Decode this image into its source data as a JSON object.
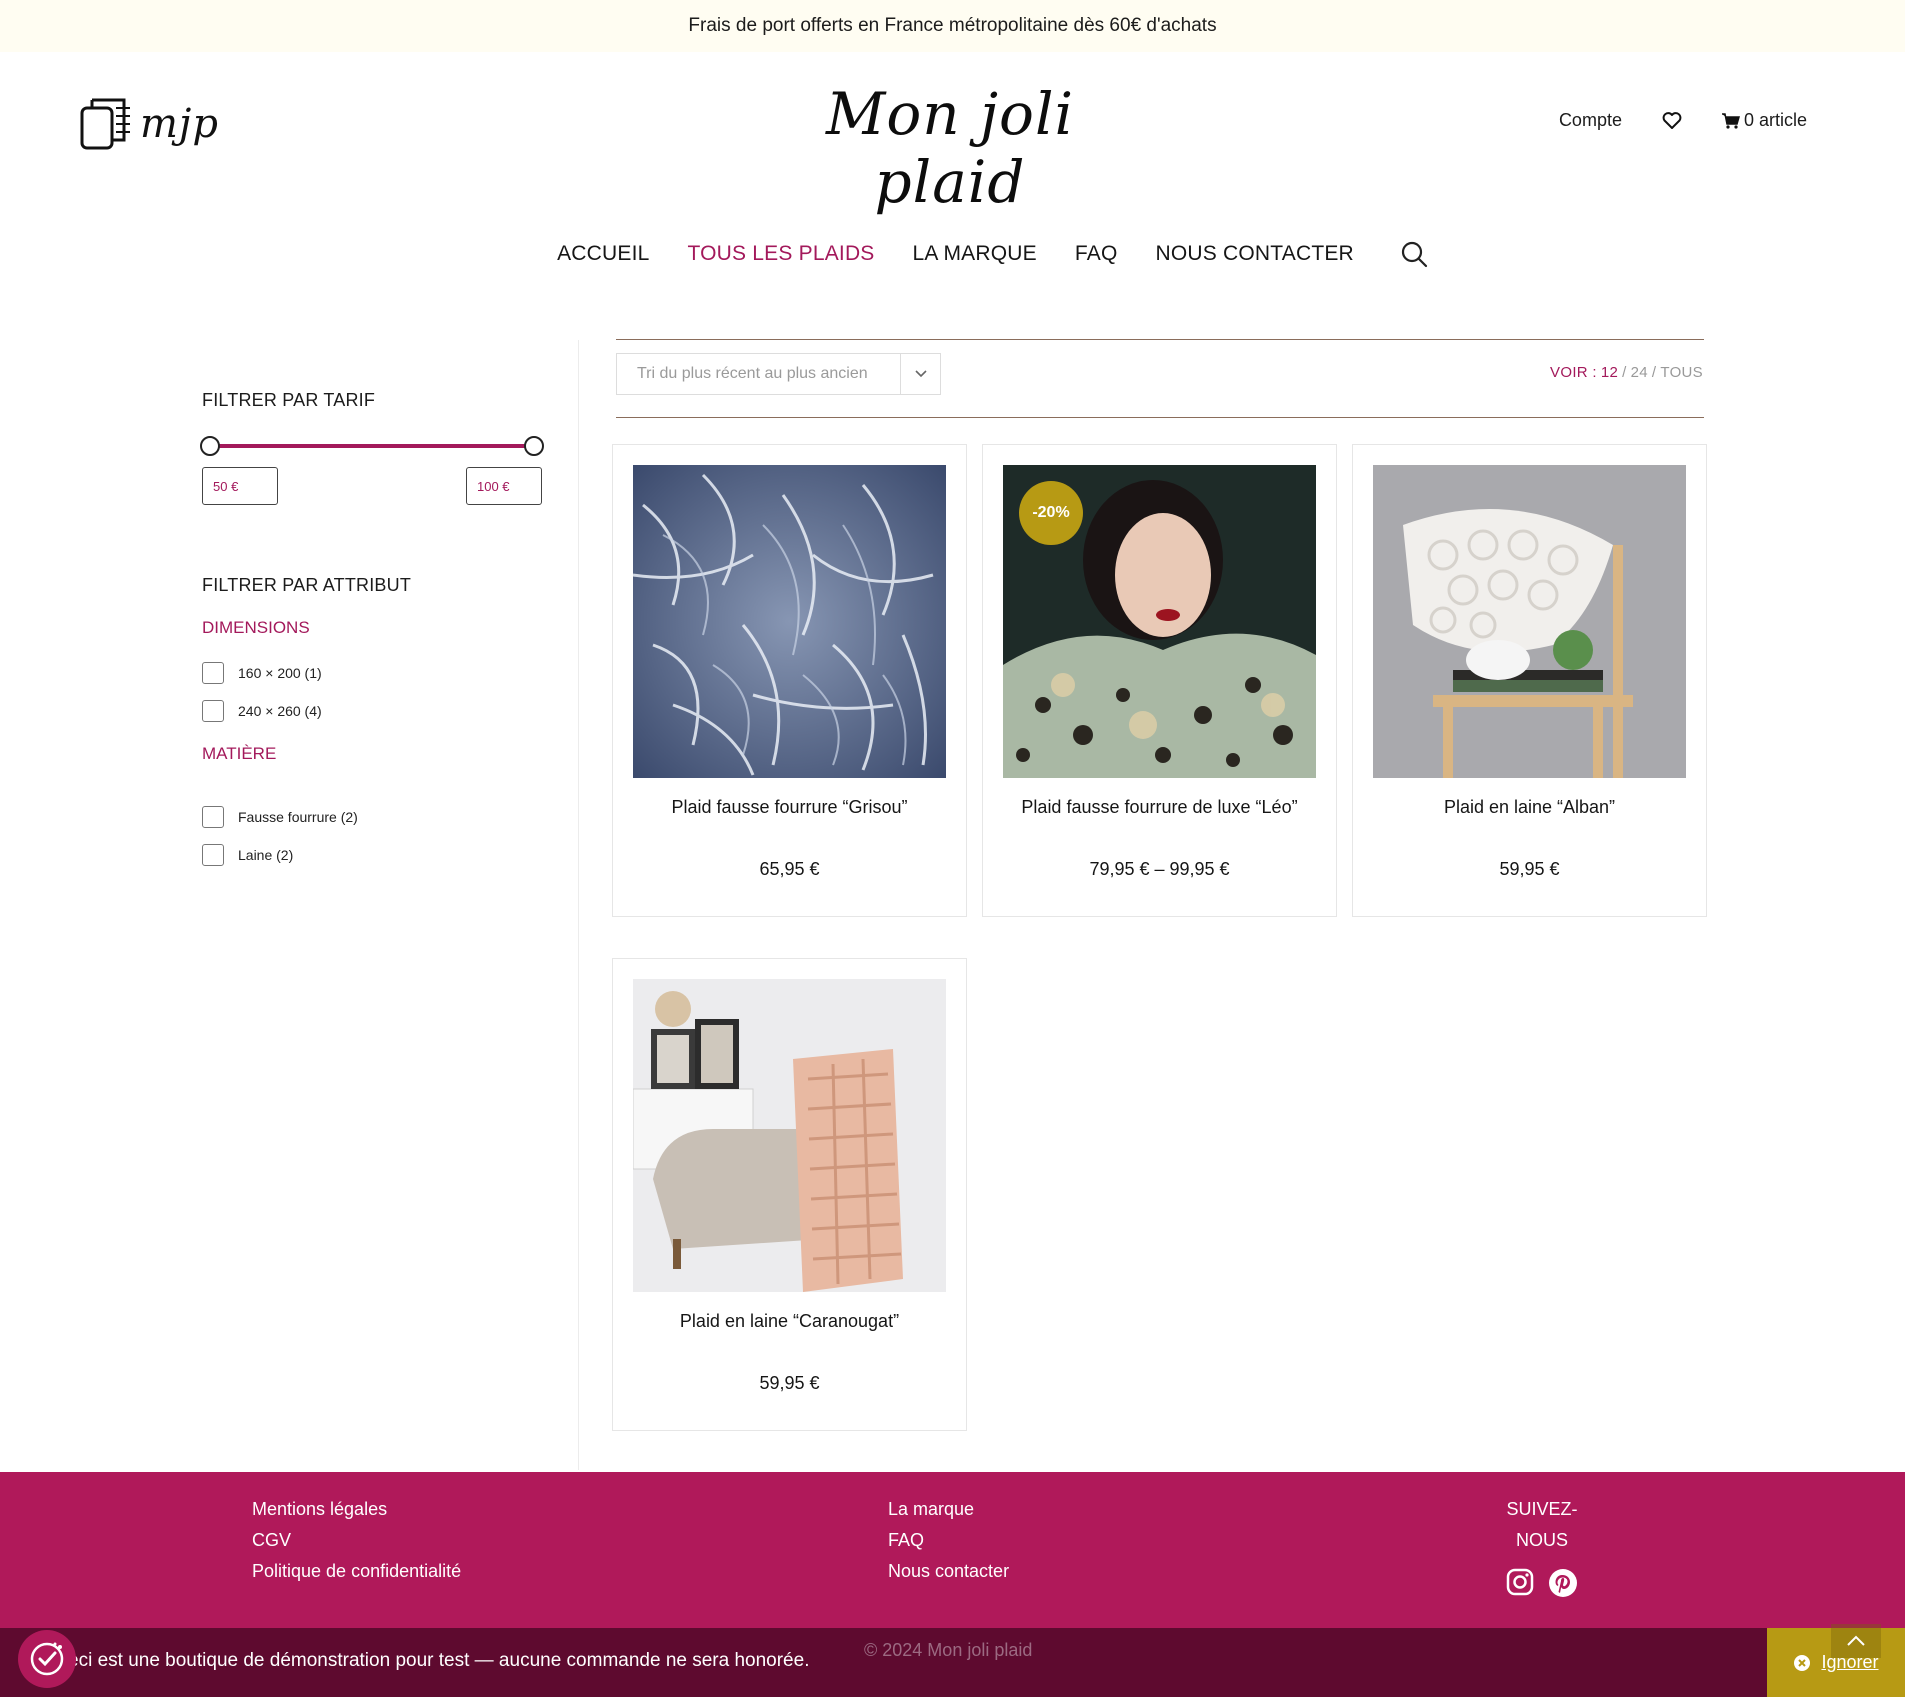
{
  "promo": {
    "text": "Frais de port offerts en France métropolitaine dès 60€ d'achats"
  },
  "header": {
    "logo_small_text": "mjp",
    "logo_main_text": "Mon joli plaid",
    "account_label": "Compte",
    "cart_label": "0 article"
  },
  "nav": {
    "items": [
      {
        "label": "ACCUEIL",
        "active": false
      },
      {
        "label": "TOUS LES PLAIDS",
        "active": true
      },
      {
        "label": "LA MARQUE",
        "active": false
      },
      {
        "label": "FAQ",
        "active": false
      },
      {
        "label": "NOUS CONTACTER",
        "active": false
      }
    ]
  },
  "sidebar": {
    "price_filter_title": "FILTRER PAR TARIF",
    "price_min": "50 €",
    "price_max": "100 €",
    "attr_filter_title": "FILTRER PAR ATTRIBUT",
    "dimensions_title": "DIMENSIONS",
    "dimensions": [
      "160 × 200 (1)",
      "240 × 260 (4)"
    ],
    "material_title": "MATIÈRE",
    "materials": [
      "Fausse fourrure (2)",
      "Laine (2)"
    ]
  },
  "toolbar": {
    "sort_label": "Tri du plus récent au plus ancien",
    "voir_label": "VOIR :",
    "per_page": [
      "12",
      "24",
      "TOUS"
    ]
  },
  "products": [
    {
      "name": "Plaid fausse fourrure “Grisou”",
      "price": "65,95 €",
      "badge": ""
    },
    {
      "name": "Plaid fausse fourrure de luxe “Léo”",
      "price": "79,95 € – 99,95 €",
      "badge": "-20%"
    },
    {
      "name": "Plaid en laine “Alban”",
      "price": "59,95 €",
      "badge": ""
    },
    {
      "name": "Plaid en laine “Caranougat”",
      "price": "59,95 €",
      "badge": ""
    }
  ],
  "footer": {
    "col1": [
      "Mentions légales",
      "CGV",
      "Politique de confidentialité"
    ],
    "col2": [
      "La marque",
      "FAQ",
      "Nous contacter"
    ],
    "follow_title": "SUIVEZ-NOUS",
    "copyright": "© 2024 Mon joli plaid",
    "demo_notice": "eci est une boutique de démonstration pour test — aucune commande ne sera honorée.",
    "dismiss_label": "Ignorer"
  },
  "colors": {
    "accent": "#a3195b",
    "footer_bg": "#b0195a",
    "bottom_bar": "#5e0a2f",
    "badge": "#b79a14",
    "promo_bg": "#fffdf2"
  },
  "icons": [
    "book-logo-icon",
    "heart-icon",
    "cart-icon",
    "search-icon",
    "chevron-down-icon",
    "instagram-icon",
    "pinterest-icon",
    "cookie-consent-icon",
    "close-circle-icon",
    "arrow-up-icon"
  ]
}
